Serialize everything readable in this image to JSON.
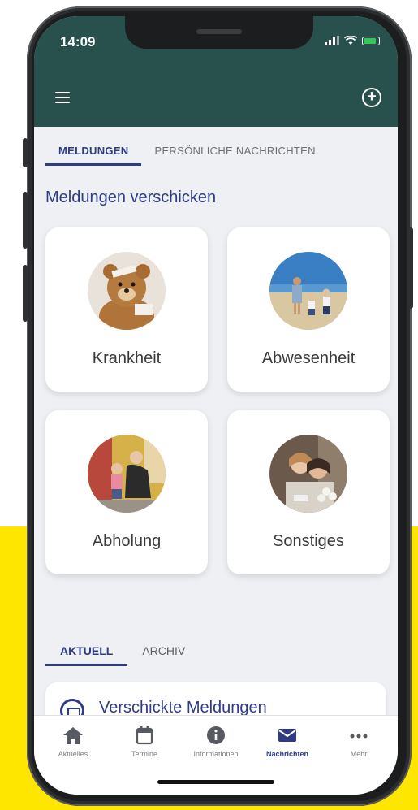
{
  "status_bar": {
    "time": "14:09"
  },
  "tabs": [
    {
      "label": "MELDUNGEN"
    },
    {
      "label": "PERSÖNLICHE NACHRICHTEN"
    }
  ],
  "section_title": "Meldungen verschicken",
  "cards": [
    {
      "label": "Krankheit",
      "image": "teddy-bear-bandage"
    },
    {
      "label": "Abwesenheit",
      "image": "family-at-beach"
    },
    {
      "label": "Abholung",
      "image": "parent-picking-up-child"
    },
    {
      "label": "Sonstiges",
      "image": "mother-and-child-flowers"
    }
  ],
  "tabs2": [
    {
      "label": "AKTUELL"
    },
    {
      "label": "ARCHIV"
    }
  ],
  "sent_title": "Verschickte Meldungen",
  "bottom_nav": [
    {
      "label": "Aktuelles",
      "icon": "home-icon"
    },
    {
      "label": "Termine",
      "icon": "calendar-icon"
    },
    {
      "label": "Informationen",
      "icon": "info-icon"
    },
    {
      "label": "Nachrichten",
      "icon": "envelope-icon"
    },
    {
      "label": "Mehr",
      "icon": "more-icon"
    }
  ],
  "colors": {
    "header": "#28504c",
    "accent": "#2e3b87",
    "background_highlight": "#ffe600"
  }
}
